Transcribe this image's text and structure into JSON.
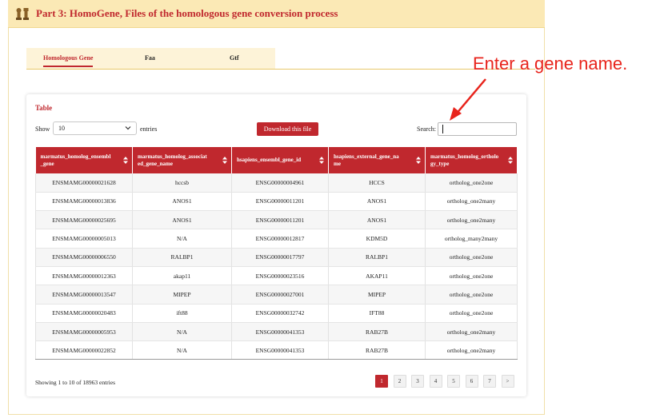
{
  "header": {
    "title": "Part 3: HomoGene, Files of the homologous gene conversion process",
    "icon": "chess-pieces-icon"
  },
  "tabs": [
    {
      "label": "Homologous Gene",
      "active": true
    },
    {
      "label": "Faa",
      "active": false
    },
    {
      "label": "Gtf",
      "active": false
    }
  ],
  "card": {
    "title": "Table",
    "show_label": "Show",
    "page_size": "10",
    "entries_label": "entries",
    "download_label": "Download this file",
    "search_label": "Search:",
    "search_value": ""
  },
  "table": {
    "columns": [
      "marmatus_homolog_ensembl_gene",
      "marmatus_homolog_associated_gene_name",
      "hsapiens_ensembl_gene_id",
      "hsapiens_external_gene_name",
      "marmatus_homolog_orthology_type"
    ],
    "column_display": [
      "marmatus_homolog_ensembl\n_gene",
      "marmatus_homolog_associat\ned_gene_name",
      "hsapiens_ensembl_gene_id",
      "hsapiens_external_gene_na\nme",
      "marmatus_homolog_ortholo\ngy_type"
    ],
    "rows": [
      [
        "ENSMAMG00000021628",
        "hccsb",
        "ENSG00000004961",
        "HCCS",
        "ortholog_one2one"
      ],
      [
        "ENSMAMG00000013836",
        "ANOS1",
        "ENSG00000011201",
        "ANOS1",
        "ortholog_one2many"
      ],
      [
        "ENSMAMG00000025695",
        "ANOS1",
        "ENSG00000011201",
        "ANOS1",
        "ortholog_one2many"
      ],
      [
        "ENSMAMG00000005013",
        "N/A",
        "ENSG00000012817",
        "KDM5D",
        "ortholog_many2many"
      ],
      [
        "ENSMAMG00000006550",
        "RALBP1",
        "ENSG00000017797",
        "RALBP1",
        "ortholog_one2one"
      ],
      [
        "ENSMAMG00000012363",
        "akap11",
        "ENSG00000023516",
        "AKAP11",
        "ortholog_one2one"
      ],
      [
        "ENSMAMG00000013547",
        "MIPEP",
        "ENSG00000027001",
        "MIPEP",
        "ortholog_one2one"
      ],
      [
        "ENSMAMG00000020483",
        "ift88",
        "ENSG00000032742",
        "IFT88",
        "ortholog_one2one"
      ],
      [
        "ENSMAMG00000005953",
        "N/A",
        "ENSG00000041353",
        "RAB27B",
        "ortholog_one2many"
      ],
      [
        "ENSMAMG00000022852",
        "N/A",
        "ENSG00000041353",
        "RAB27B",
        "ortholog_one2many"
      ]
    ]
  },
  "footer": {
    "info": "Showing 1 to 10 of 18963 entries",
    "pages": [
      "1",
      "2",
      "3",
      "4",
      "5",
      "6",
      "7",
      ">"
    ],
    "active_page": "1"
  },
  "annotation": {
    "text": "Enter a gene name.",
    "color": "#e8241c"
  },
  "colors": {
    "accent": "#c0282e",
    "header_bg": "#fbe9b5",
    "tab_bg": "#fdf3d8"
  }
}
